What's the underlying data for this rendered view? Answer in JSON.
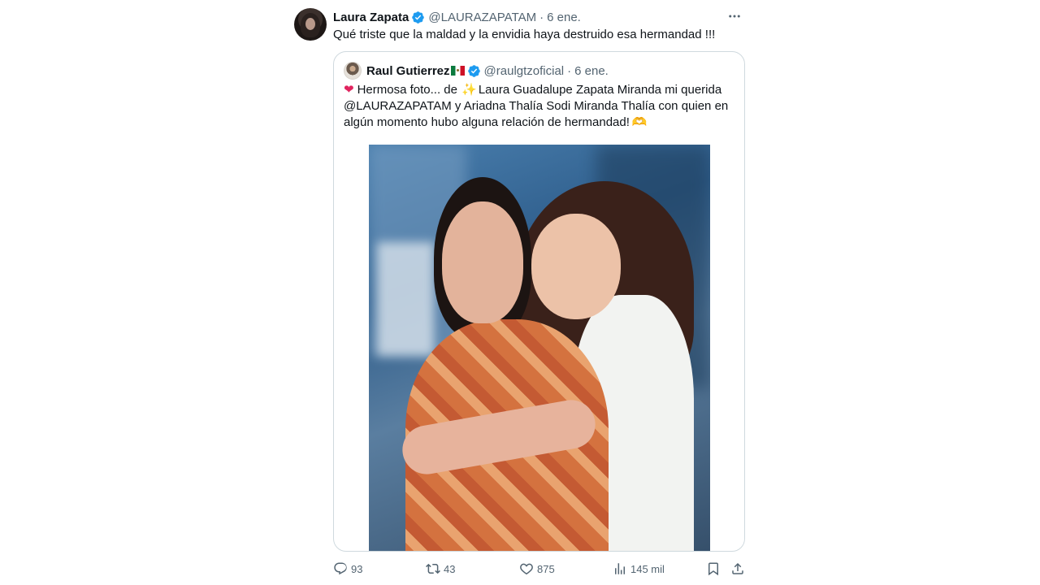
{
  "tweet": {
    "author_name": "Laura Zapata",
    "handle": "@LAURAZAPATAM",
    "separator": "·",
    "date": "6 ene.",
    "more_icon": "more-horizontal-icon",
    "text": "Qué triste que la maldad y la envidia haya destruido esa hermandad !!!"
  },
  "quote": {
    "author_name": "Raul Gutierrez",
    "flag_icon": "mexico-flag-icon",
    "handle": "@raulgtzoficial",
    "separator": "·",
    "date": "6 ene.",
    "line1_a": "Hermosa foto... de",
    "line1_b": "Laura Guadalupe Zapata Miranda mi querida",
    "line2": "@LAURAZAPATAM  y Ariadna Thalía Sodi Miranda  Thalía con quien en",
    "line3": "algún momento hubo alguna relación de hermandad!"
  },
  "actions": {
    "replies": "93",
    "retweets": "43",
    "likes": "875",
    "views": "145 mil"
  },
  "colors": {
    "text": "#0f1419",
    "secondary": "#536471",
    "border": "#cfd9de",
    "verified": "#1d9bf0"
  }
}
